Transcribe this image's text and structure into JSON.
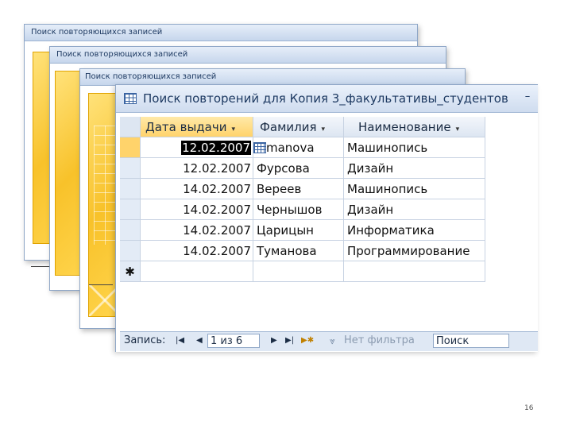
{
  "background_windows": [
    {
      "title": "Поиск повторяющихся записей"
    },
    {
      "title": "Поиск повторяющихся записей"
    },
    {
      "title": "Поиск повторяющихся записей"
    }
  ],
  "datasheet": {
    "title": "Поиск повторений для Копия 3_факультативы_студентов",
    "minimize_glyph": "–",
    "columns": [
      {
        "label": "Дата выдачи"
      },
      {
        "label": "Фамилия"
      },
      {
        "label": "Наименование"
      }
    ],
    "dropdown_glyph": "▾",
    "new_row_glyph": "✱",
    "rows": [
      {
        "date": "12.02.2007",
        "surname": "manova",
        "name": "Машинопись"
      },
      {
        "date": "12.02.2007",
        "surname": "Фурсова",
        "name": "Дизайн"
      },
      {
        "date": "14.02.2007",
        "surname": "Вереев",
        "name": "Машинопись"
      },
      {
        "date": "14.02.2007",
        "surname": "Чернышов",
        "name": "Дизайн"
      },
      {
        "date": "14.02.2007",
        "surname": "Царицын",
        "name": "Информатика"
      },
      {
        "date": "14.02.2007",
        "surname": "Туманова",
        "name": "Программирование"
      }
    ]
  },
  "navigation": {
    "record_label": "Запись:",
    "first_glyph": "|◀",
    "prev_glyph": "◀",
    "current": "1 из 6",
    "next_glyph": "▶",
    "last_glyph": "▶|",
    "new_glyph": "▶✱",
    "filter_label": "Нет фильтра",
    "search_label": "Поиск"
  },
  "slide_number": "16",
  "colors": {
    "accent": "#ffd36b",
    "title_text": "#1e3a62"
  }
}
